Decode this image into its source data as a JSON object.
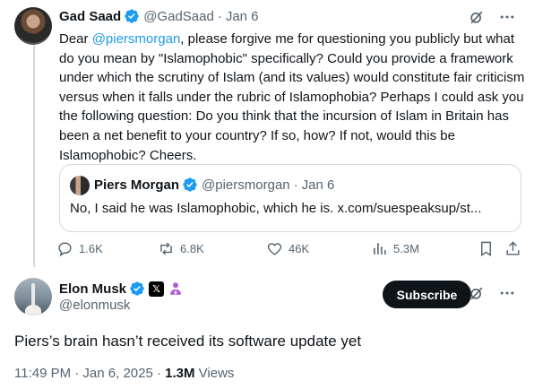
{
  "colors": {
    "accent": "#1d9bf0",
    "text": "#0f1419",
    "muted": "#536471",
    "border": "#cfd9de"
  },
  "reply_tweet": {
    "author_name": "Gad Saad",
    "handle": "@GadSaad",
    "separator": "·",
    "time": "Jan 6",
    "text_prefix": "Dear ",
    "mention": "@piersmorgan",
    "text_body": ", please forgive me for questioning you publicly but what do you mean by \"Islamophobic\" specifically?  Could you provide a framework under which the scrutiny of Islam (and its values) would constitute fair criticism versus when it falls under the rubric of Islamophobia?  Perhaps I could ask you the following question:  Do you think that the incursion of Islam in Britain has been a net benefit to your country?  If so, how?  If not, would this be Islamophobic?  Cheers.",
    "quoted": {
      "author_name": "Piers Morgan",
      "handle": "@piersmorgan",
      "separator": "·",
      "time": "Jan 6",
      "text": "No, I said he was Islamophobic, which he is. x.com/suespeaksup/st..."
    },
    "stats": {
      "replies": "1.6K",
      "reposts": "6.8K",
      "likes": "46K",
      "views": "5.3M"
    },
    "icons": [
      "grok-icon",
      "more-icon",
      "reply-icon",
      "repost-icon",
      "like-icon",
      "views-icon",
      "bookmark-icon",
      "share-icon"
    ]
  },
  "main_tweet": {
    "author_name": "Elon Musk",
    "handle": "@elonmusk",
    "x_badge": "𝕏",
    "subscribe_label": "Subscribe",
    "text": "Piers’s brain hasn’t received its software update yet",
    "timestamp": "11:49 PM · Jan 6, 2025 · ",
    "views_count": "1.3M",
    "views_label": " Views"
  }
}
